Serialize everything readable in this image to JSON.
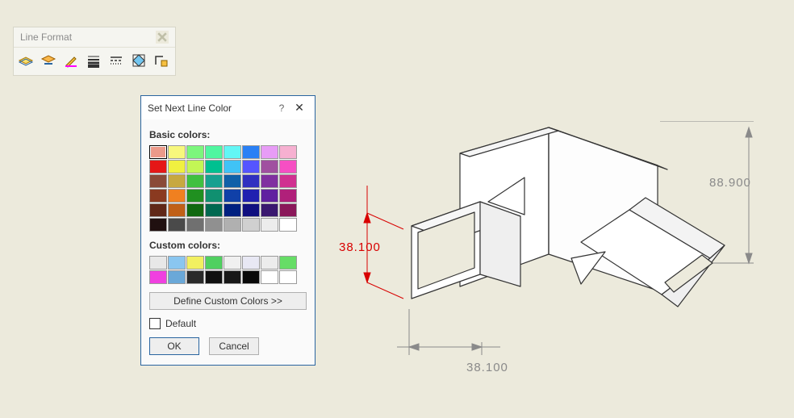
{
  "toolbar": {
    "title": "Line Format",
    "tools": [
      {
        "name": "layer-properties-icon",
        "underline": "#2a65a0"
      },
      {
        "name": "change-layer-icon",
        "underline": "#2a65a0"
      },
      {
        "name": "line-color-icon",
        "underline": "#ff00ff"
      },
      {
        "name": "line-thickness-icon",
        "underline": ""
      },
      {
        "name": "line-style-icon",
        "underline": ""
      },
      {
        "name": "color-display-icon",
        "underline": ""
      },
      {
        "name": "hide-show-edge-icon",
        "underline": ""
      }
    ]
  },
  "dialog": {
    "title": "Set Next Line Color",
    "help_symbol": "?",
    "close_symbol": "✕",
    "basic_label": "Basic colors:",
    "custom_label": "Custom colors:",
    "define_button": "Define Custom Colors >>",
    "default_label": "Default",
    "ok_label": "OK",
    "cancel_label": "Cancel",
    "basic_colors": [
      [
        "#ec9a8a",
        "#f7f77d",
        "#7cf67c",
        "#50f6a0",
        "#63f6f5",
        "#2a80f5",
        "#e79cf6",
        "#f6b0d1"
      ],
      [
        "#e51717",
        "#f0f040",
        "#c3f655",
        "#00c090",
        "#40c3f6",
        "#5555ff",
        "#a050a0",
        "#f64fc3"
      ],
      [
        "#8a4a38",
        "#c7a840",
        "#40c040",
        "#18a090",
        "#1060a8",
        "#3030c0",
        "#8030a0",
        "#d03090"
      ],
      [
        "#8a3a20",
        "#f08020",
        "#209020",
        "#109070",
        "#1040a8",
        "#2020b0",
        "#6020a0",
        "#b0207a"
      ],
      [
        "#602818",
        "#c06018",
        "#106810",
        "#006850",
        "#002080",
        "#101080",
        "#3a1870",
        "#8a185a"
      ],
      [
        "#201010",
        "#4a4a4a",
        "#707070",
        "#909090",
        "#b0b0b0",
        "#d0d0d0",
        "#ececec",
        "#ffffff"
      ]
    ],
    "selected_basic": [
      0,
      0
    ],
    "custom_colors": [
      [
        "#e8e8e8",
        "#8ac6f0",
        "#f2f060",
        "#50d060",
        "#f0f0f0",
        "#e8e8f4",
        "#ececec",
        "#66dd66"
      ],
      [
        "#f040e0",
        "#6aa8d8",
        "#2a2a2a",
        "#101010",
        "#181818",
        "#0a0a0a",
        "#ffffff",
        "#ffffff"
      ]
    ]
  },
  "dimensions": {
    "d1": "38.100",
    "d2": "38.100",
    "d3": "88.900"
  }
}
